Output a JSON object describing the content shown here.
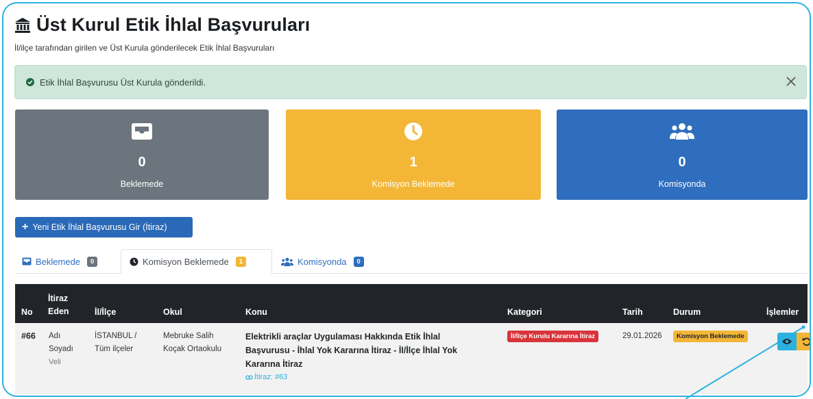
{
  "page": {
    "title": "Üst Kurul Etik İhlal Başvuruları",
    "subtitle": "İl/ilçe tarafından girilen ve Üst Kurula gönderilecek Etik İhlal Başvuruları",
    "title_icon": "bank-icon"
  },
  "alert": {
    "message": "Etik İhlal Başvurusu Üst Kurula gönderildi.",
    "icon": "check-circle-icon",
    "close_icon": "close-icon"
  },
  "cards": [
    {
      "count": "0",
      "label": "Beklemede",
      "icon": "inbox-icon",
      "color": "#6c757d"
    },
    {
      "count": "1",
      "label": "Komisyon Beklemede",
      "icon": "clock-icon",
      "color": "#f3b637"
    },
    {
      "count": "0",
      "label": "Komisyonda",
      "icon": "users-icon",
      "color": "#2f6ebe"
    }
  ],
  "new_button": {
    "label": "Yeni Etik İhlal Başvurusu Gir (İtiraz)"
  },
  "tabs": [
    {
      "label": "Beklemede",
      "badge": "0",
      "icon": "inbox-icon"
    },
    {
      "label": "Komisyon Beklemede",
      "badge": "1",
      "icon": "clock-icon",
      "active": true
    },
    {
      "label": "Komisyonda",
      "badge": "0",
      "icon": "users-icon"
    }
  ],
  "table": {
    "headers": {
      "no": "No",
      "itiraz_line1": "İtiraz",
      "itiraz_line2": "Eden",
      "il_ilce": "İl/İlçe",
      "okul": "Okul",
      "konu": "Konu",
      "kategori": "Kategori",
      "tarih": "Tarih",
      "durum": "Durum",
      "islemler": "İşlemler"
    },
    "rows": [
      {
        "no": "#66",
        "eden_line1": "Adı",
        "eden_line2": "Soyadı",
        "eden_role": "Veli",
        "il": "İSTANBUL /",
        "ilce": "Tüm ilçeler",
        "okul_line1": "Mebruke Salih",
        "okul_line2": "Koçak Ortaokulu",
        "konu_line1": "Elektrikli araçlar Uygulaması Hakkında Etik İhlal",
        "konu_line2": "Başvurusu - İhlal Yok Kararına İtiraz - İl/İlçe İhlal Yok",
        "konu_line3": "Kararına İtiraz",
        "link": "İtiraz: #63",
        "kategori": "İl/İlçe Kurulu Kararına İtiraz",
        "tarih": "29.01.2026",
        "durum": "Komisyon Beklemede"
      }
    ]
  },
  "colors": {
    "frame": "#2bb1e0",
    "alert_bg": "#cfe6dc",
    "table_head": "#212529",
    "danger": "#d9343b",
    "warning": "#f3b637",
    "info": "#2bb1e0"
  }
}
